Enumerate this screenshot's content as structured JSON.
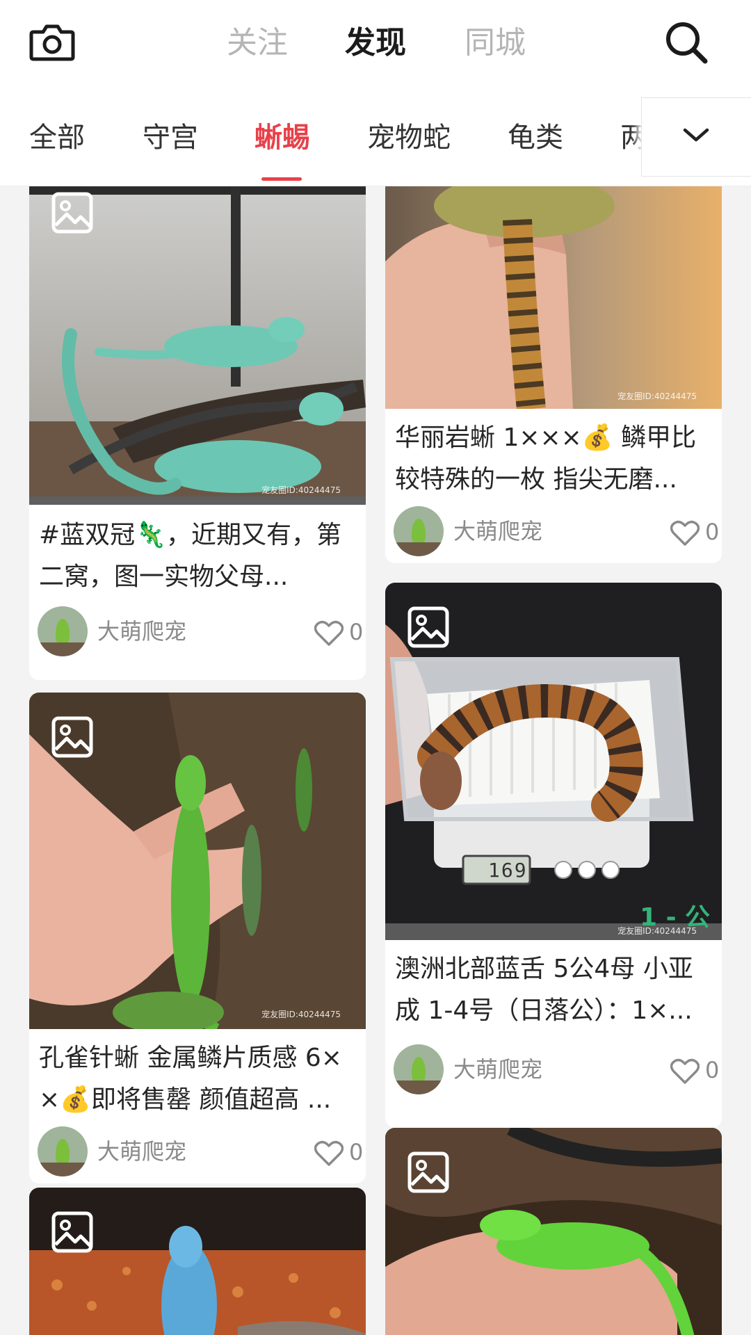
{
  "header": {
    "tabs": [
      {
        "label": "关注",
        "active": false
      },
      {
        "label": "发现",
        "active": true
      },
      {
        "label": "同城",
        "active": false
      }
    ],
    "icons": [
      "camera-icon",
      "search-icon"
    ]
  },
  "categories": {
    "items": [
      "全部",
      "守宫",
      "蜥蜴",
      "宠物蛇",
      "龟类",
      "两"
    ],
    "active_index": 2,
    "accent_color": "#e8414a",
    "more_icon": "chevron-down-icon"
  },
  "posts": [
    {
      "title": "#蓝双冠🦎，近期又有，第二窝，图一实物父母...",
      "author": "大萌爬宠",
      "likes": "0",
      "watermark": "宠友圈ID:40244475"
    },
    {
      "title": "孔雀针蜥 金属鳞片质感 6××💰即将售罄 颜值超高 ...",
      "author": "大萌爬宠",
      "likes": "0",
      "watermark": "宠友圈ID:40244475"
    },
    {
      "title": "",
      "author": "",
      "likes": ""
    },
    {
      "title": "华丽岩蜥 1×××💰 鳞甲比较特殊的一枚 指尖无磨...",
      "author": "大萌爬宠",
      "likes": "0",
      "watermark": "宠友圈ID:40244475"
    },
    {
      "title": "澳洲北部蓝舌 5公4母 小亚成 1-4号（日落公）：1×...",
      "author": "大萌爬宠",
      "likes": "0",
      "watermark": "宠友圈ID:40244475",
      "overlay_text": "1 - 公",
      "scale_reading": "169"
    },
    {
      "title": "",
      "author": "",
      "likes": ""
    }
  ]
}
